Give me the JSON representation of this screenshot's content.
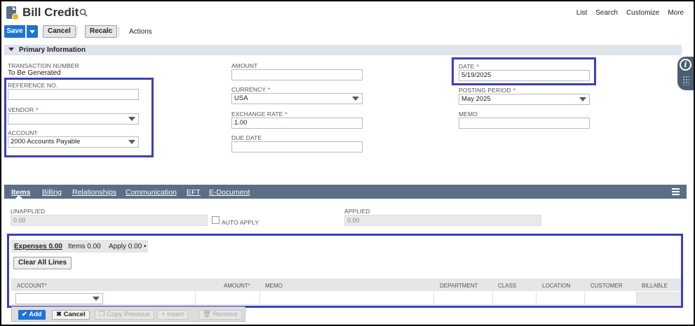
{
  "page": {
    "title": "Bill Credit",
    "nav": [
      "List",
      "Search",
      "Customize",
      "More"
    ]
  },
  "toolbar": {
    "save_label": "Save",
    "cancel_label": "Cancel",
    "recalc_label": "Recalc",
    "actions_label": "Actions"
  },
  "primary": {
    "section_title": "Primary Information",
    "transaction_number": {
      "label": "TRANSACTION NUMBER",
      "value": "To Be Generated"
    },
    "reference_no": {
      "label": "REFERENCE NO.",
      "value": ""
    },
    "vendor": {
      "label": "VENDOR",
      "value": ""
    },
    "account": {
      "label": "ACCOUNT",
      "value": "2000 Accounts Payable"
    },
    "amount": {
      "label": "AMOUNT",
      "value": ""
    },
    "currency": {
      "label": "CURRENCY",
      "value": "USA"
    },
    "exchange_rate": {
      "label": "EXCHANGE RATE",
      "value": "1.00"
    },
    "due_date": {
      "label": "DUE DATE",
      "value": ""
    },
    "date": {
      "label": "DATE",
      "value": "5/19/2025"
    },
    "posting_period": {
      "label": "POSTING PERIOD",
      "value": "May 2025"
    },
    "memo": {
      "label": "MEMO",
      "value": ""
    },
    "required_mark": "*"
  },
  "tabs": [
    {
      "label": "Items",
      "active": true
    },
    {
      "label": "Billing"
    },
    {
      "label": "Relationships"
    },
    {
      "label": "Communication"
    },
    {
      "label": "EFT"
    },
    {
      "label": "E-Document"
    }
  ],
  "apply": {
    "unapplied_label": "UNAPPLIED",
    "unapplied_value": "0.00",
    "auto_apply_label": "AUTO APPLY",
    "applied_label": "APPLIED",
    "applied_value": "0.00"
  },
  "sublist": {
    "tabs": [
      "Expenses 0.00",
      "Items 0.00",
      "Apply 0.00 •"
    ],
    "clear_label": "Clear All Lines",
    "columns": [
      "ACCOUNT",
      "AMOUNT",
      "MEMO",
      "DEPARTMENT",
      "CLASS",
      "LOCATION",
      "CUSTOMER",
      "BILLABLE"
    ],
    "add_label": "Add",
    "cancel_label": "Cancel",
    "copy_label": "Copy Previous",
    "insert_label": "Insert",
    "remove_label": "Remove"
  },
  "colors": {
    "primary_button": "#1f73d4",
    "tab_bar": "#5a6f86",
    "highlight": "#3b3ec0",
    "required": "#e88a00"
  }
}
